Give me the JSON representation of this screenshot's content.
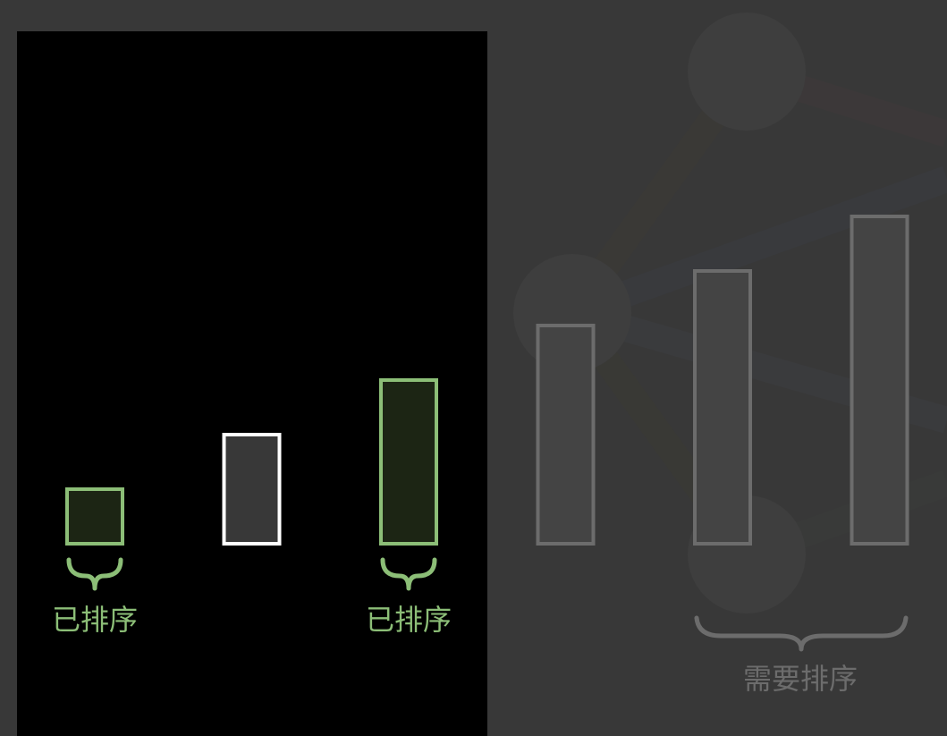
{
  "colors": {
    "background": "#383838",
    "panel": "#000000",
    "sorted_stroke": "#8cbe77",
    "sorted_fill": "#1c2514",
    "current_stroke": "#ffffff",
    "current_fill": "#383838",
    "unsorted_stroke": "#6c6c6c",
    "unsorted_fill": "#444444"
  },
  "bars": [
    {
      "state": "sorted",
      "value": 1
    },
    {
      "state": "current",
      "value": 2
    },
    {
      "state": "sorted",
      "value": 3
    },
    {
      "state": "unsorted",
      "value": 4
    },
    {
      "state": "unsorted",
      "value": 5
    },
    {
      "state": "unsorted",
      "value": 6
    }
  ],
  "labels": {
    "sorted": "已排序",
    "unsorted": "需要排序"
  }
}
